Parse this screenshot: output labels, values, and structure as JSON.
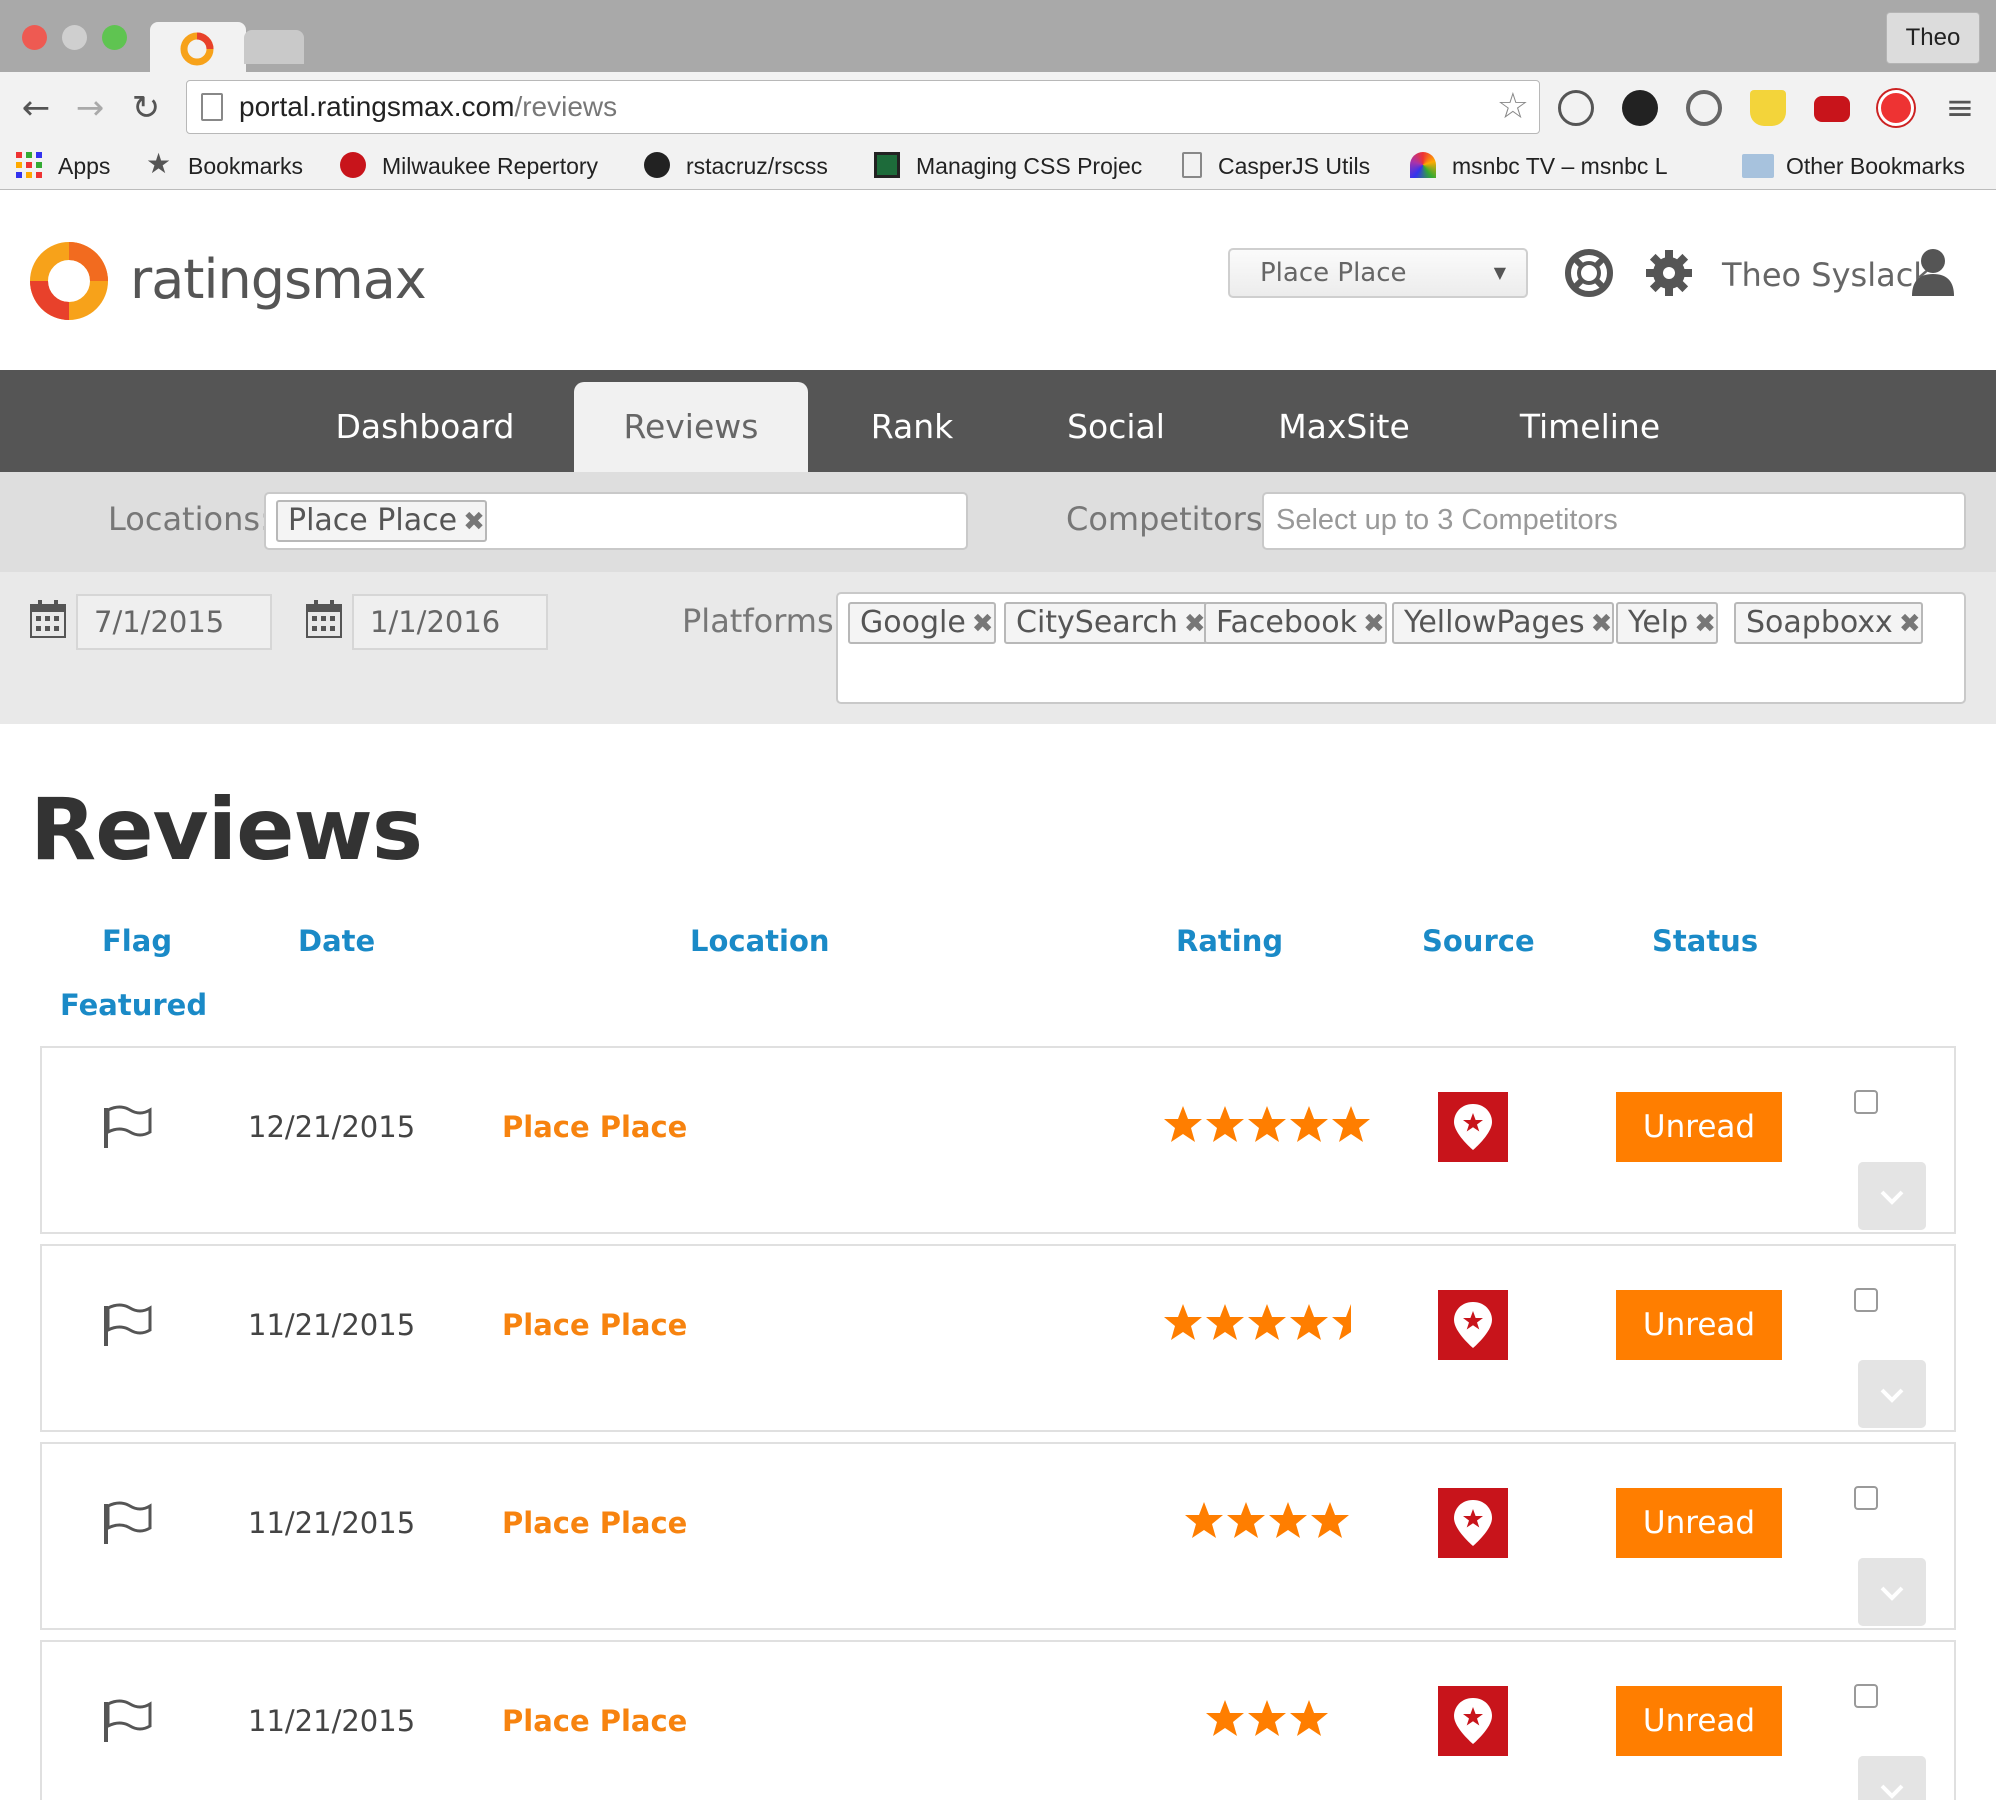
{
  "browser": {
    "url_host": "portal.ratingsmax.com",
    "url_path": "/reviews",
    "profile": "Theo",
    "bookmarks": [
      {
        "label": "Apps",
        "icon": "apps-grid-icon"
      },
      {
        "label": "Bookmarks",
        "icon": "star-icon"
      },
      {
        "label": "Milwaukee Repertory",
        "icon": "rep-icon"
      },
      {
        "label": "rstacruz/rscss",
        "icon": "github-icon"
      },
      {
        "label": "Managing CSS Projec",
        "icon": "doc-icon"
      },
      {
        "label": "CasperJS Utils",
        "icon": "page-icon"
      },
      {
        "label": "msnbc TV – msnbc L",
        "icon": "peacock-icon"
      },
      {
        "label": "Other Bookmarks",
        "icon": "folder-icon"
      }
    ]
  },
  "header": {
    "logo": "ratingsmax",
    "place_select": "Place Place",
    "user_name": "Theo Syslack"
  },
  "nav": {
    "tabs": [
      {
        "label": "Dashboard",
        "active": false
      },
      {
        "label": "Reviews",
        "active": true
      },
      {
        "label": "Rank",
        "active": false
      },
      {
        "label": "Social",
        "active": false
      },
      {
        "label": "MaxSite",
        "active": false
      },
      {
        "label": "Timeline",
        "active": false
      }
    ]
  },
  "filters": {
    "locations_label": "Locations:",
    "location_chips": [
      "Place Place"
    ],
    "competitors_label": "Competitors:",
    "competitors_placeholder": "Select up to 3 Competitors",
    "date_from": "7/1/2015",
    "date_to": "1/1/2016",
    "platforms_label": "Platforms:",
    "platform_chips": [
      "Google",
      "CitySearch",
      "Facebook",
      "YellowPages",
      "Yelp",
      "Soapboxx"
    ],
    "chip_remove": "✖"
  },
  "reviews": {
    "title": "Reviews",
    "columns": {
      "flag": "Flag",
      "date": "Date",
      "location": "Location",
      "rating": "Rating",
      "source": "Source",
      "status": "Status",
      "featured": "Featured"
    },
    "rows": [
      {
        "date": "12/21/2015",
        "location": "Place Place",
        "rating": 5,
        "status": "Unread"
      },
      {
        "date": "11/21/2015",
        "location": "Place Place",
        "rating": 4.5,
        "status": "Unread"
      },
      {
        "date": "11/21/2015",
        "location": "Place Place",
        "rating": 4,
        "status": "Unread"
      },
      {
        "date": "11/21/2015",
        "location": "Place Place",
        "rating": 3,
        "status": "Unread"
      }
    ]
  },
  "colors": {
    "accent_orange": "#ff7e00",
    "link_blue": "#1a8ac7",
    "source_red": "#c8141b",
    "nav_bg": "#555555"
  }
}
